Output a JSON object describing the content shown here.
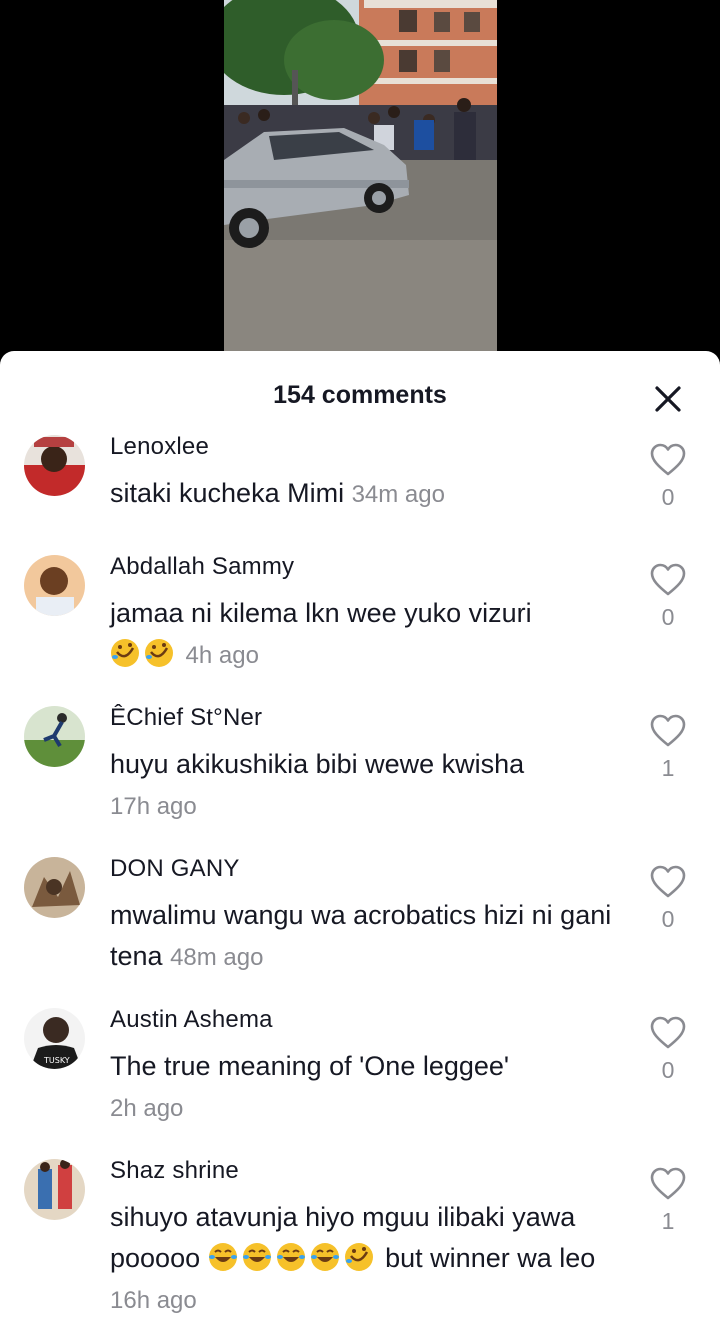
{
  "header": {
    "comment_count": "154 comments"
  },
  "comments": [
    {
      "username": "Lenoxlee",
      "text": "sitaki kucheka Mimi",
      "emojis": [],
      "time": "34m ago",
      "likes": "0",
      "avatar_colors": [
        "#c22a2a",
        "#e8e2dc"
      ]
    },
    {
      "username": "Abdallah Sammy",
      "text": "jamaa ni kilema lkn wee yuko vizuri",
      "emojis": [
        "rofl-emoji",
        "rofl-emoji"
      ],
      "time": "4h ago",
      "likes": "0",
      "avatar_colors": [
        "#f2c89c",
        "#6b3f22"
      ]
    },
    {
      "username": "ÊChief St°Ner",
      "text": "huyu akikushikia bibi wewe kwisha",
      "emojis": [],
      "time": "17h ago",
      "likes": "1",
      "avatar_colors": [
        "#5f8f3a",
        "#d8e4cf"
      ]
    },
    {
      "username": "DON GANY",
      "text": "mwalimu wangu wa acrobatics hizi ni gani tena",
      "emojis": [],
      "time": "48m ago",
      "likes": "0",
      "avatar_colors": [
        "#7a5a3e",
        "#c8b49a"
      ]
    },
    {
      "username": "Austin Ashema",
      "text": "The true meaning of 'One leggee'",
      "emojis": [],
      "time": "2h ago",
      "likes": "0",
      "avatar_colors": [
        "#1b1b1b",
        "#f3f3f3"
      ]
    },
    {
      "username": "Shaz shrine",
      "text": "sihuyo atavunja hiyo mguu ilibaki yawa pooooo",
      "emojis_inline": [
        "joy-emoji",
        "joy-emoji",
        "joy-emoji",
        "joy-emoji",
        "rofl-emoji"
      ],
      "text_after": "but winner wa leo",
      "time": "16h ago",
      "likes": "1",
      "avatar_colors": [
        "#3a6fb0",
        "#e4d7c4"
      ]
    }
  ],
  "colors": {
    "text_primary": "#161823",
    "text_secondary": "#8a8b91",
    "sheet_background": "#ffffff",
    "video_letterbox": "#000000"
  },
  "icons": {
    "close": "close-icon",
    "like": "heart-outline-icon"
  }
}
